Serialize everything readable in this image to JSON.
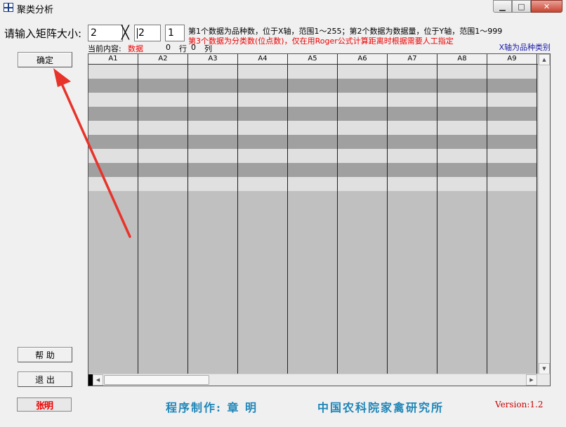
{
  "window": {
    "title": "聚类分析",
    "controls": {
      "minimize": "▁",
      "maximize": "□",
      "close": "✕"
    }
  },
  "form": {
    "prompt": "请输入矩阵大小:",
    "field1": "2",
    "times": "╳",
    "field2": "2",
    "field3": "1",
    "hint_line1": "第1个数据为品种数，位于X轴，范围1～255；第2个数据为数据量，位于Y轴，范围1～999",
    "hint_line2": "第3个数据为分类数(位点数)，仅在用Roger公式计算距离时根据需要人工指定",
    "current_label": "当前内容:",
    "current_value": "数据",
    "rows_value": "0",
    "rows_unit": "行",
    "cols_value": "0",
    "cols_unit": "列",
    "x_axis_note": "X轴为品种类别"
  },
  "buttons": {
    "ok": "确定",
    "help": "帮  助",
    "exit": "退  出"
  },
  "grid": {
    "columns": [
      "A1",
      "A2",
      "A3",
      "A4",
      "A5",
      "A6",
      "A7",
      "A8",
      "A9"
    ]
  },
  "footer": {
    "logo": "张明",
    "author": "程序制作: 章  明",
    "org": "中国农科院家禽研究所",
    "version": "Version:1.2"
  },
  "colors": {
    "hint_red": "#ee0000",
    "footer_blue": "#1f86b8",
    "note_blue": "#1a1aa8",
    "arrow_red": "#e8332a"
  }
}
